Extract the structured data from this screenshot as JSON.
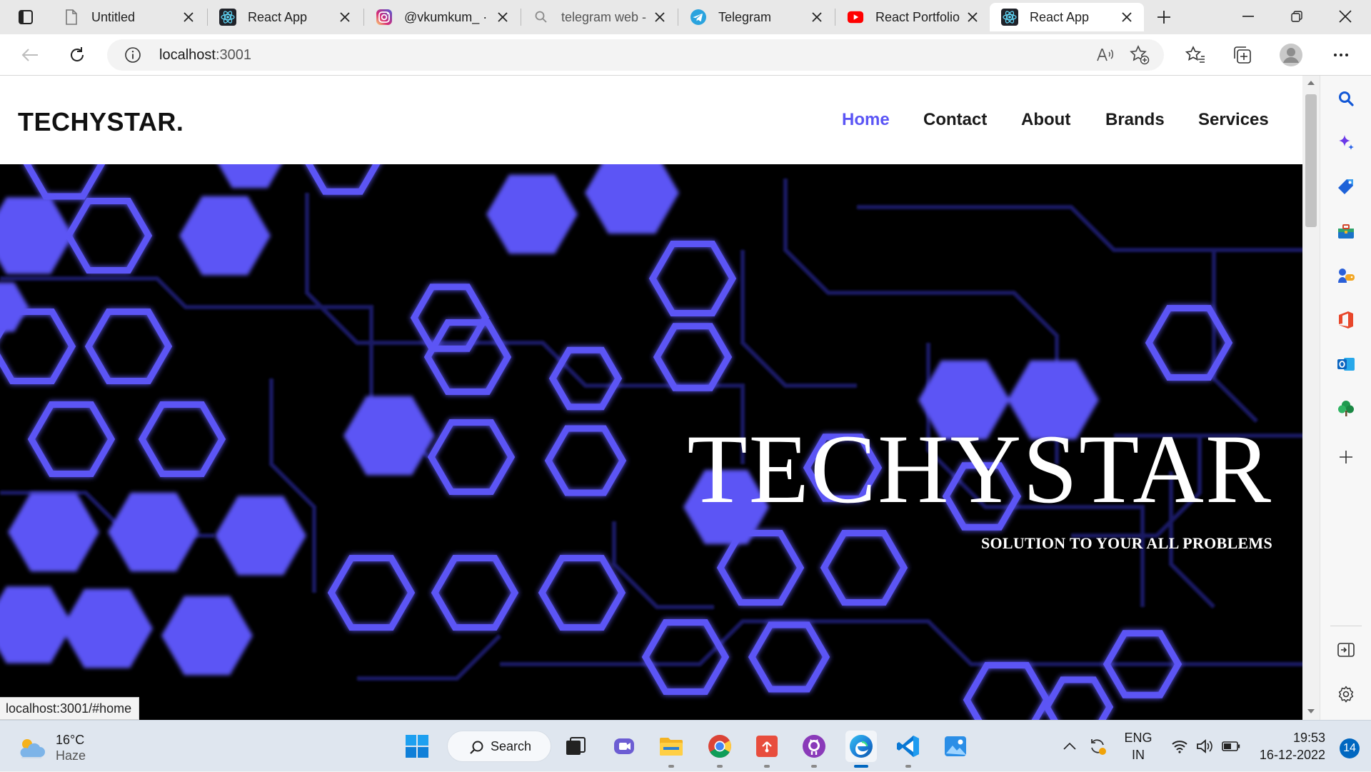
{
  "browser": {
    "tabs": [
      {
        "title": "Untitled",
        "favicon": "document-icon",
        "active": false
      },
      {
        "title": "React App",
        "favicon": "react-icon",
        "active": false
      },
      {
        "title": "@vkumkum_ ·",
        "favicon": "instagram-icon",
        "active": false
      },
      {
        "title": "telegram web -",
        "favicon": "search-icon",
        "active": false
      },
      {
        "title": "Telegram",
        "favicon": "telegram-icon",
        "active": false
      },
      {
        "title": "React Portfolio",
        "favicon": "youtube-icon",
        "active": false
      },
      {
        "title": "React App",
        "favicon": "react-icon",
        "active": true
      }
    ],
    "address": {
      "host": "localhost",
      "path": ":3001"
    },
    "status_url": "localhost:3001/#home"
  },
  "site": {
    "brand": "TECHYSTAR.",
    "nav": [
      {
        "label": "Home",
        "active": true
      },
      {
        "label": "Contact",
        "active": false
      },
      {
        "label": "About",
        "active": false
      },
      {
        "label": "Brands",
        "active": false
      },
      {
        "label": "Services",
        "active": false
      }
    ],
    "hero": {
      "title": "TECHYSTAR",
      "subtitle": "SOLUTION TO YOUR ALL PROBLEMS",
      "accent_color": "#5b55f5"
    }
  },
  "taskbar": {
    "weather": {
      "temp": "16°C",
      "condition": "Haze"
    },
    "search_label": "Search",
    "language": {
      "line1": "ENG",
      "line2": "IN"
    },
    "clock": {
      "time": "19:53",
      "date": "16-12-2022"
    },
    "notification_count": "14"
  }
}
